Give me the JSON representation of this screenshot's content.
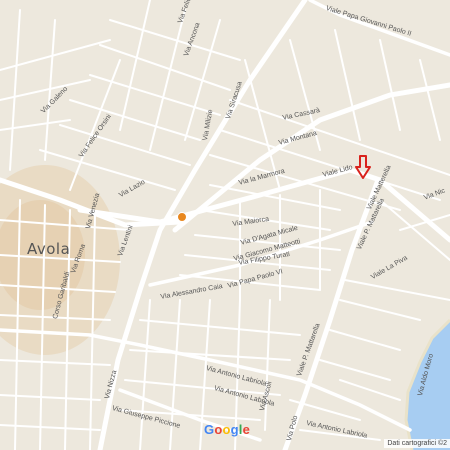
{
  "map": {
    "city_label": "Avola",
    "attribution": "Dati cartografici ©2",
    "logo": [
      {
        "ch": "G",
        "color": "#4285F4"
      },
      {
        "ch": "o",
        "color": "#EA4335"
      },
      {
        "ch": "o",
        "color": "#FBBC05"
      },
      {
        "ch": "g",
        "color": "#4285F4"
      },
      {
        "ch": "l",
        "color": "#34A853"
      },
      {
        "ch": "e",
        "color": "#EA4335"
      }
    ],
    "colors": {
      "land": "#ede8dd",
      "urban": "#e8d4ba",
      "road": "#ffffff",
      "sea": "#a7cdf2",
      "marker": "#d9221c",
      "poi": "#e8871e"
    },
    "marker_icon": "down-arrow-marker-icon",
    "poi_icon": "orange-poi-icon",
    "street_labels": [
      "Via Felic",
      "Viale Papa Giovanni Paolo II",
      "Via Ancona",
      "Via Siracusa",
      "Via Cassarà",
      "Via Montana",
      "Via Galeno",
      "Via Felice Orsini",
      "Via Milizie",
      "Via la Marmora",
      "Viale Lido",
      "Viale Matterella",
      "Via Nic",
      "Via Lazio",
      "Via Maiorca",
      "Via D'Agata Micale",
      "Via Filippo Turati",
      "Via Giacomo Matteotti",
      "Viale P. Mattarella",
      "Via Venezia",
      "Via Lentini",
      "Via Roma",
      "Via Papa Paolo VI",
      "Viale La Piva",
      "Corso Garibaldi",
      "Via Alessandro Caia",
      "Via Nizza",
      "Viale P. Mattarella",
      "Via Antonio Labriola",
      "Via Aldo Moro",
      "Via Antonio Labriola",
      "Via Giuseppe Piccione",
      "Via Ascoli",
      "Via Polo",
      "Via Antonio Labriola"
    ]
  }
}
